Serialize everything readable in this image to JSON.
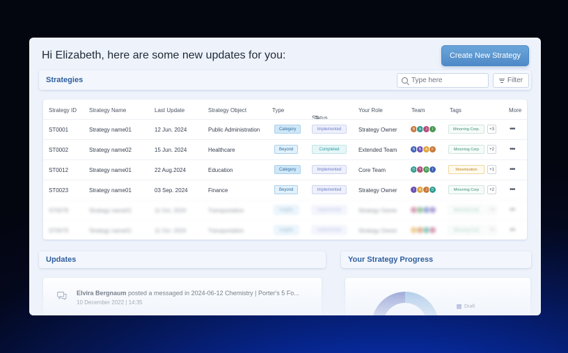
{
  "header": {
    "greeting": "Hi Elizabeth, here are some new updates for you:",
    "create_button": "Create New Strategy"
  },
  "strategies": {
    "title": "Strategies",
    "search_placeholder": "Type here",
    "filter_label": "Filter",
    "columns": [
      "Strategy ID",
      "Strategy Name",
      "Last Update",
      "Strategy Object",
      "Type",
      "Status",
      "Your Role",
      "Team",
      "Tags",
      "More"
    ],
    "rows": [
      {
        "id": "ST0001",
        "name": "Strategy name01",
        "updated": "12 Jun. 2024",
        "object": "Public Administration",
        "type": "Category",
        "status": "Implemented",
        "role": "Strategy Owner",
        "team": [
          "B",
          "A",
          "J",
          "I"
        ],
        "tag": "Minorring Corp.",
        "more_tags": "+3"
      },
      {
        "id": "ST0002",
        "name": "Strategy name02",
        "updated": "15 Jun. 2024",
        "object": "Healthcare",
        "type": "Beyond",
        "status": "Completed",
        "role": "Extended Team",
        "team": [
          "N",
          "B",
          "A",
          "F"
        ],
        "tag": "Minorring Corp",
        "more_tags": "+2"
      },
      {
        "id": "ST0012",
        "name": "Strategy name01",
        "updated": "22 Aug.2024",
        "object": "Education",
        "type": "Category",
        "status": "Implemented",
        "role": "Core Team",
        "team": [
          "O",
          "Y",
          "D",
          "I"
        ],
        "tag": "Monetization",
        "more_tags": "+1"
      },
      {
        "id": "ST0023",
        "name": "Strategy name01",
        "updated": "03 Sep. 2024",
        "object": "Finance",
        "type": "Beyond",
        "status": "Implemented",
        "role": "Strategy Owner",
        "team": [
          "I",
          "A",
          "J",
          "D"
        ],
        "tag": "Minorring Corp",
        "more_tags": "+2"
      },
      {
        "id": "ST0078",
        "name": "Strategy name01",
        "updated": "11 Oct. 2024",
        "object": "Transportation",
        "type": "Insights",
        "status": "Implemented",
        "role": "Strategy Owner",
        "team": [
          "",
          "",
          "",
          ""
        ],
        "tag": "Minorring Corp",
        "more_tags": "+2"
      },
      {
        "id": "ST0079",
        "name": "Strategy name01",
        "updated": "11 Oct. 2024",
        "object": "Transportation",
        "type": "Insights",
        "status": "Implemented",
        "role": "Strategy Owner",
        "team": [
          "",
          "",
          "",
          ""
        ],
        "tag": "Minorring Corp",
        "more_tags": "+2"
      }
    ]
  },
  "updates": {
    "title": "Updates",
    "item": {
      "author": "Elvira Bergnaum",
      "text": " posted a messaged in 2024-06-12 Chemistry | Porter's 5 Fo...",
      "date": "10 December 2022 | 14:35"
    }
  },
  "progress": {
    "title": "Your Strategy Progress",
    "legend_draft": "Draft"
  },
  "colors": {
    "accent": "#2f5e9e",
    "button": "#5b97d2",
    "avatar_palette": [
      "#c9763b",
      "#3f63b8",
      "#2d9b8e",
      "#6b4fb2",
      "#b54b7a",
      "#e0a53a",
      "#4a9a52"
    ]
  }
}
